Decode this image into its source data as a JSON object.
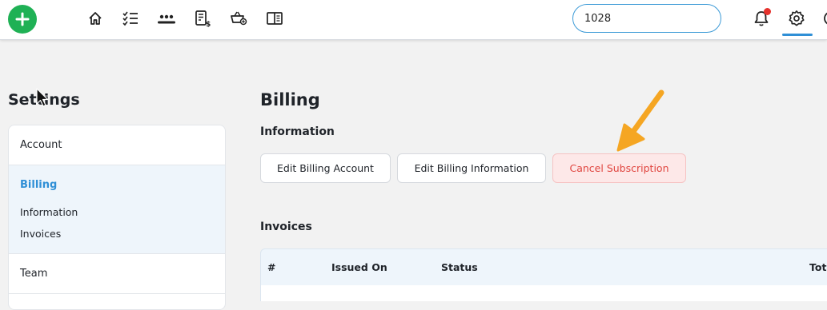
{
  "header": {
    "nav_icons": [
      "home-icon",
      "checklist-icon",
      "team-icon",
      "invoice-icon",
      "basket-icon",
      "book-icon"
    ],
    "search": {
      "value": "1028"
    },
    "accent": "#2f8fd6",
    "add_color": "#1fb155"
  },
  "sidebar": {
    "title": "Settings",
    "items": [
      {
        "label": "Account"
      },
      {
        "label": "Billing",
        "subitems": [
          "Information",
          "Invoices"
        ]
      },
      {
        "label": "Team"
      }
    ]
  },
  "main": {
    "title": "Billing",
    "information": {
      "title": "Information",
      "buttons": [
        "Edit Billing Account",
        "Edit Billing Information",
        "Cancel Subscription"
      ]
    },
    "invoices": {
      "title": "Invoices",
      "columns": [
        "#",
        "Issued On",
        "Status",
        "Tota"
      ]
    }
  },
  "colors": {
    "danger": "#e0453f",
    "annotation_arrow": "#f5a623"
  }
}
